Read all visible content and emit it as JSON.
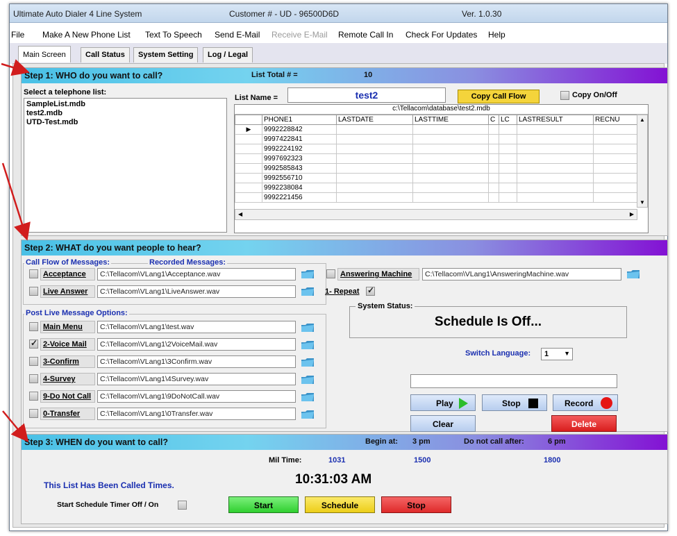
{
  "window": {
    "app_title": "Ultimate Auto Dialer 4 Line System",
    "customer": "Customer # - UD - 96500D6D",
    "version": "Ver. 1.0.30"
  },
  "menu": [
    "File",
    "Make A New Phone List",
    "Text To Speech",
    "Send E-Mail",
    "Receive E-Mail",
    "Remote Call In",
    "Check For Updates",
    "Help"
  ],
  "tabs": [
    "Main Screen",
    "Call Status",
    "System Setting",
    "Log / Legal"
  ],
  "step1": {
    "title": "Step 1: WHO do you want to call?",
    "list_total_label": "List Total # =",
    "list_total": "10",
    "select_label": "Select a telephone list:",
    "lists": [
      "SampleList.mdb",
      "test2.mdb",
      "UTD-Test.mdb"
    ],
    "list_name_label": "List Name =",
    "list_name": "test2",
    "copy_call_flow": "Copy Call Flow",
    "copy_onoff": "Copy On/Off",
    "grid_path": "c:\\Tellacom\\database\\test2.mdb",
    "columns": [
      "PHONE1",
      "LASTDATE",
      "LASTTIME",
      "C",
      "LC",
      "LASTRESULT",
      "RECNU"
    ],
    "phones": [
      "9992228842",
      "9997422841",
      "9992224192",
      "9997692323",
      "9992585843",
      "9992556710",
      "9992238084",
      "9992221456"
    ]
  },
  "step2": {
    "title": "Step 2: WHAT do you want people to hear?",
    "call_flow_label": "Call Flow of Messages:",
    "recorded_label": "Recorded Messages:",
    "acceptance_label": "Acceptance",
    "acceptance_path": "C:\\Tellacom\\VLang1\\Acceptance.wav",
    "live_answer_label": "Live Answer",
    "live_answer_path": "C:\\Tellacom\\VLang1\\LiveAnswer.wav",
    "answering_machine_label": "Answering Machine",
    "answering_machine_path": "C:\\Tellacom\\VLang1\\AnsweringMachine.wav",
    "repeat_label": "1- Repeat",
    "post_live_label": "Post  Live Message Options:",
    "options": [
      {
        "label": "Main Menu",
        "path": "C:\\Tellacom\\VLang1\\test.wav",
        "checked": false
      },
      {
        "label": "2-Voice Mail",
        "path": "C:\\Tellacom\\VLang1\\2VoiceMail.wav",
        "checked": true
      },
      {
        "label": "3-Confirm",
        "path": "C:\\Tellacom\\VLang1\\3Confirm.wav",
        "checked": false
      },
      {
        "label": "4-Survey",
        "path": "C:\\Tellacom\\VLang1\\4Survey.wav",
        "checked": false
      },
      {
        "label": "9-Do Not Call",
        "path": "C:\\Tellacom\\VLang1\\9DoNotCall.wav",
        "checked": false
      },
      {
        "label": "0-Transfer",
        "path": "C:\\Tellacom\\VLang1\\0Transfer.wav",
        "checked": false
      }
    ],
    "system_status_label": "System Status:",
    "system_status": "Schedule Is Off...",
    "switch_language_label": "Switch Language:",
    "language": "1",
    "play": "Play",
    "stop": "Stop",
    "record": "Record",
    "clear": "Clear",
    "delete": "Delete"
  },
  "step3": {
    "title": "Step 3: WHEN do you want to call?",
    "begin_label": "Begin at:",
    "begin": "3 pm",
    "nocall_label": "Do not call after:",
    "nocall": "6 pm",
    "mil_label": "Mil Time:",
    "mil_now": "1031",
    "mil_begin": "1500",
    "mil_end": "1800",
    "called_text": "This List Has Been Called  Times.",
    "clock": "10:31:03 AM",
    "timer_label": "Start Schedule Timer Off / On",
    "start": "Start",
    "schedule": "Schedule",
    "stop": "Stop"
  },
  "colors": {
    "accent_arrow": "#d11d1d",
    "band_start": "#49c0e6",
    "band_end": "#8312d4",
    "start_green": "#4fe04f",
    "schedule_yellow": "#f4e03a",
    "stop_red": "#ec3a3a"
  }
}
